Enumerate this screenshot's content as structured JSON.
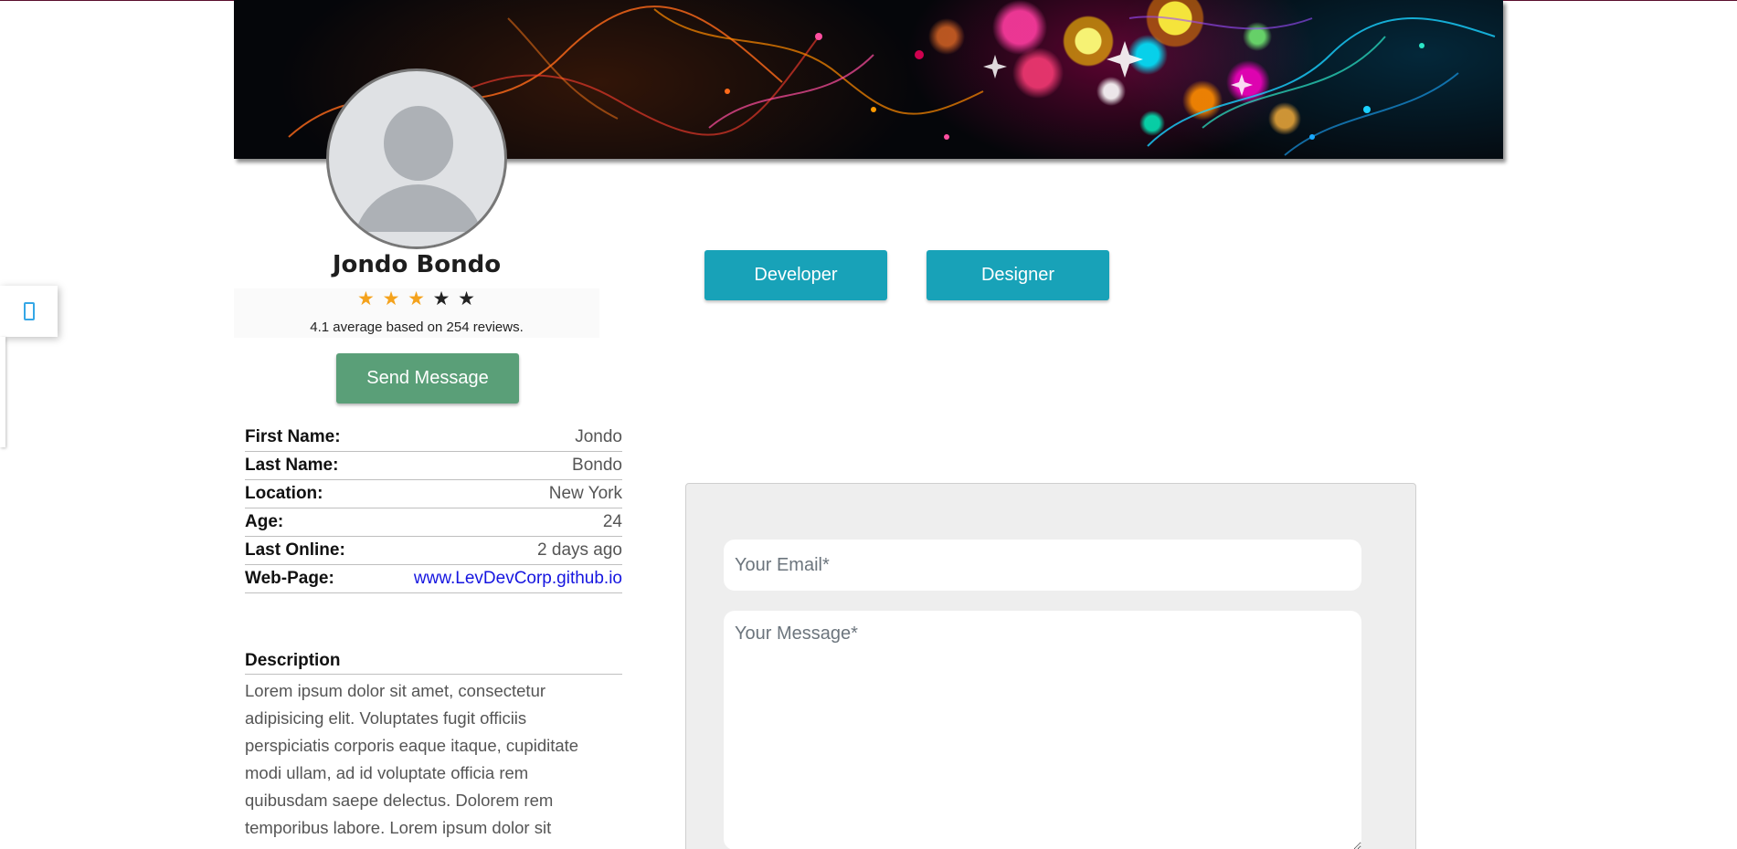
{
  "profile": {
    "name": "Jondo Bondo",
    "rating": {
      "stars_filled": 3,
      "stars_total": 5,
      "text": "4.1 average based on 254 reviews."
    },
    "send_message_label": "Send Message"
  },
  "details": [
    {
      "label": "First Name:",
      "value": "Jondo"
    },
    {
      "label": "Last Name:",
      "value": "Bondo"
    },
    {
      "label": "Location:",
      "value": "New York"
    },
    {
      "label": "Age:",
      "value": "24"
    },
    {
      "label": "Last Online:",
      "value": "2 days ago"
    },
    {
      "label": "Web-Page:",
      "value": "www.LevDevCorp.github.io"
    }
  ],
  "description": {
    "title": "Description",
    "lines": [
      "Lorem ipsum dolor sit amet, consectetur",
      "adipisicing elit. Voluptates fugit officiis",
      "perspiciatis corporis eaque itaque, cupiditate",
      "modi ullam, ad id voluptate officia rem",
      "quibusdam saepe delectus. Dolorem rem",
      "temporibus labore. Lorem ipsum dolor sit"
    ]
  },
  "tags": {
    "developer": "Developer",
    "designer": "Designer"
  },
  "contact_form": {
    "email_placeholder": "Your Email*",
    "message_placeholder": "Your Message*"
  },
  "colors": {
    "send_button": "#5a9f78",
    "tag_button": "#18a2b8",
    "star_on": "#f4a21c",
    "star_off": "#222222",
    "link": "#1515e0"
  },
  "icons": {
    "side_widget": "phone-icon",
    "star": "star-icon"
  }
}
